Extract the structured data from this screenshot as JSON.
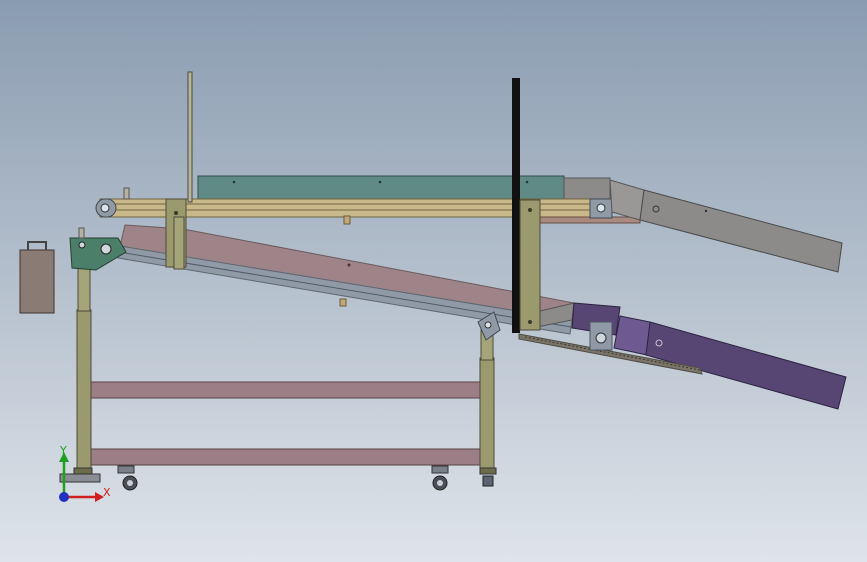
{
  "viewport": {
    "background_top": "#8a9cb0",
    "background_bottom": "#dfe4ea"
  },
  "colors": {
    "frame": "#9b9a6e",
    "frame_dark": "#6d6c4a",
    "upper_belt": "#5f8a86",
    "upper_rail": "#c9b98a",
    "lower_belt": "#9e8488",
    "lower_rail": "#8f9aa6",
    "cross_bar": "#9c7f86",
    "chute_grey": "#8d8b8a",
    "chute_purple": "#574673",
    "bracket_green": "#4c7f6a",
    "motor_box": "#8a7b74",
    "post_black": "#111111",
    "axis_x": "#d02020",
    "axis_y": "#20a020",
    "axis_origin": "#2030c0"
  },
  "triad": {
    "x_label": "X",
    "y_label": "Y",
    "x_icon": "x-axis-arrow-icon",
    "y_icon": "y-axis-arrow-icon"
  }
}
